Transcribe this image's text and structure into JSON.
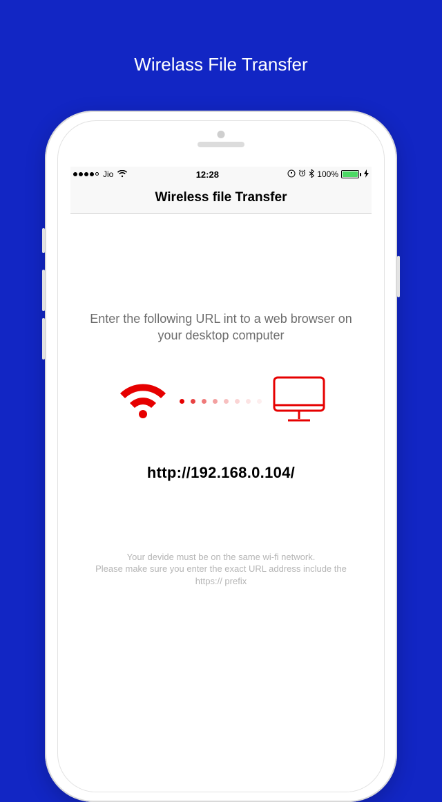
{
  "page": {
    "title": "Wirelass File Transfer"
  },
  "status_bar": {
    "carrier": "Jio",
    "time": "12:28",
    "battery_pct": "100%"
  },
  "nav": {
    "title": "Wireless file Transfer"
  },
  "main": {
    "instruction": "Enter the following URL int to a web browser on your desktop computer",
    "url": "http://192.168.0.104/",
    "footnote_line1": "Your devide must be on the same wi-fi network.",
    "footnote_line2": "Please make sure you enter the exact URL address include the https:// prefix"
  },
  "colors": {
    "accent_red": "#e60000",
    "dot_trail": [
      "#e60000",
      "#e84242",
      "#ef7a7a",
      "#f3a0a0",
      "#f7c0c0",
      "#fad4d4",
      "#fce3e3",
      "#fdeeee"
    ]
  }
}
